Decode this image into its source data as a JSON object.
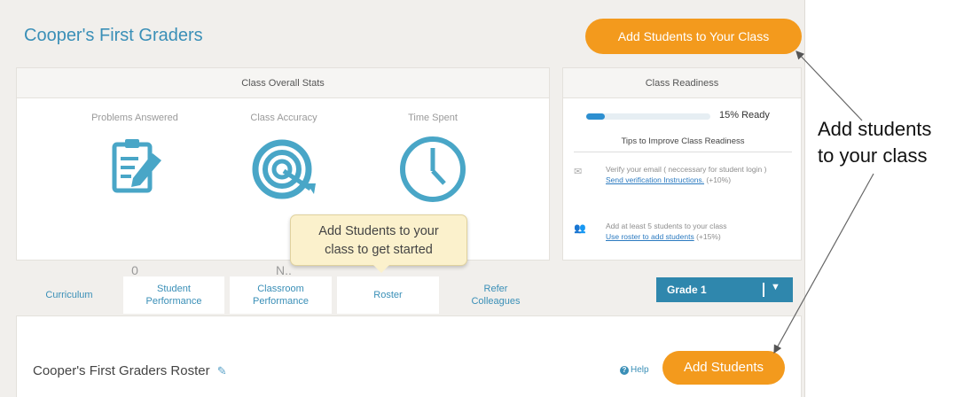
{
  "header": {
    "class_title": "Cooper's First Graders",
    "add_students_class_label": "Add Students to Your Class"
  },
  "stats": {
    "title": "Class Overall Stats",
    "items": [
      {
        "label": "Problems Answered",
        "value": "0",
        "icon": "worksheet-pencil-icon"
      },
      {
        "label": "Class Accuracy",
        "value": "N..",
        "icon": "target-icon"
      },
      {
        "label": "Time Spent",
        "value": "",
        "icon": "clock-icon"
      }
    ]
  },
  "readiness": {
    "title": "Class Readiness",
    "progress_percent": 15,
    "progress_text": "15% Ready",
    "tips_title": "Tips to Improve Class Readiness",
    "tips": [
      {
        "icon": "email-icon",
        "text": "Verify your email ( neccessary for student login )",
        "link": "Send verification Instructions.",
        "bonus": "(+10%)"
      },
      {
        "icon": "users-icon",
        "text": "Add at least 5 students to your class",
        "link": "Use roster to add students",
        "bonus": "(+15%)"
      }
    ]
  },
  "tooltip": {
    "line1": "Add Students to your",
    "line2": "class to get started"
  },
  "tabs": [
    {
      "label": "Curriculum",
      "active": false
    },
    {
      "label": "Student Performance",
      "active": true
    },
    {
      "label": "Classroom Performance",
      "active": true
    },
    {
      "label": "Roster",
      "active": true
    },
    {
      "label": "Refer Colleagues",
      "active": false
    }
  ],
  "grade_select": {
    "value": "Grade 1"
  },
  "roster": {
    "title": "Cooper's First Graders Roster",
    "help_label": "Help",
    "add_students_label": "Add Students"
  },
  "annotation": {
    "line1": "Add students",
    "line2": "to your class"
  },
  "colors": {
    "accent_blue": "#3a8fb7",
    "orange": "#f39a1d",
    "progress_blue": "#2d8fd0",
    "tooltip_bg": "#fbf1cc"
  }
}
